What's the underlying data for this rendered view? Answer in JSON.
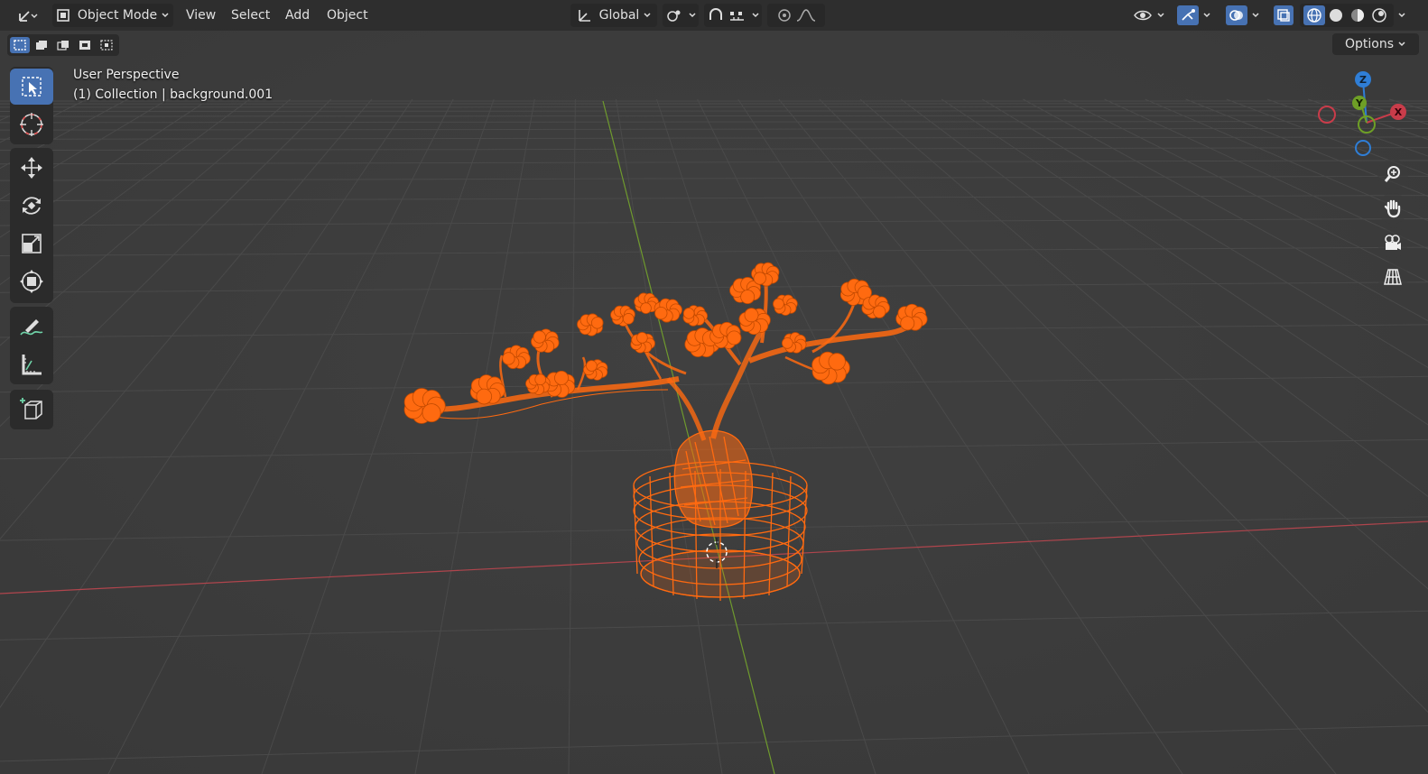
{
  "header": {
    "mode_label": "Object Mode",
    "menus": [
      "View",
      "Select",
      "Add",
      "Object"
    ],
    "orientation_label": "Global"
  },
  "tool_settings": {
    "options_label": "Options"
  },
  "viewport": {
    "view_name": "User Perspective",
    "collection_info": "(1) Collection | background.001"
  },
  "gizmo": {
    "axes": [
      "Z",
      "Y",
      "X"
    ]
  },
  "colors": {
    "accent": "#4772b3",
    "selection": "#ff6a10",
    "x_axis": "#c93c4a",
    "y_axis": "#6e9f26",
    "z_axis": "#2f7ed6"
  }
}
